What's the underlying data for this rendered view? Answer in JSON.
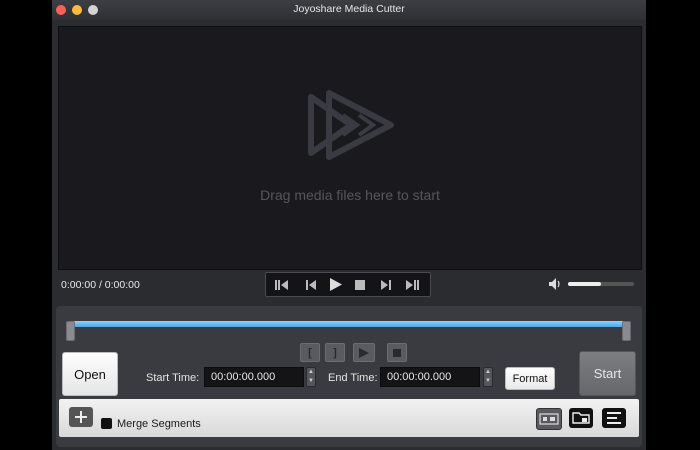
{
  "window": {
    "title": "Joyoshare Media Cutter"
  },
  "preview": {
    "drop_text": "Drag media files here to start"
  },
  "player": {
    "time_readout": "0:00:00 / 0:00:00",
    "volume_level": 0.5
  },
  "trim": {
    "start_label": "Start Time:",
    "start_value": "00:00:00.000",
    "end_label": "End Time:",
    "end_value": "00:00:00.000"
  },
  "buttons": {
    "open": "Open",
    "format": "Format",
    "start": "Start"
  },
  "toolbar": {
    "merge_label": "Merge Segments"
  },
  "segment_buttons": {
    "mark_in": "[",
    "mark_out": "]"
  },
  "icons": [
    "close-light",
    "minimize-light",
    "maximize-light",
    "play-logo-icon",
    "previous-icon",
    "step-back-icon",
    "play-icon",
    "stop-icon",
    "step-forward-icon",
    "next-icon",
    "volume-icon",
    "add-icon",
    "edit-icon",
    "folder-icon",
    "list-icon"
  ],
  "colors": {
    "timeline": "#4aa8e8",
    "close": "#fc605b",
    "minimize": "#fdbc40"
  }
}
